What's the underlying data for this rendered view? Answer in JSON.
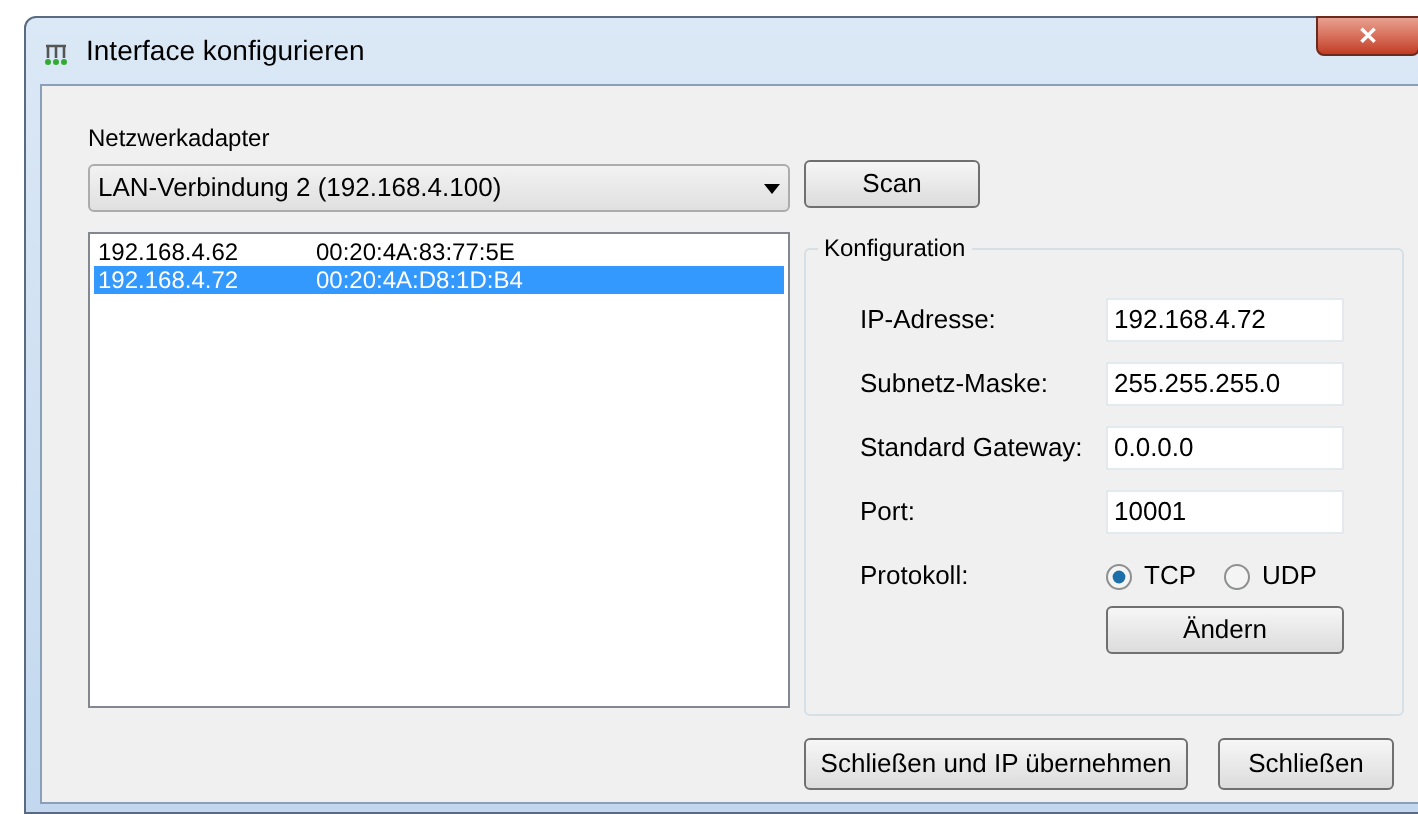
{
  "window": {
    "title": "Interface konfigurieren",
    "close": "✕"
  },
  "adapter": {
    "label": "Netzwerkadapter",
    "value": "LAN-Verbindung 2 (192.168.4.100)",
    "scan": "Scan"
  },
  "devices": [
    {
      "ip": "192.168.4.62",
      "mac": "00:20:4A:83:77:5E",
      "selected": false
    },
    {
      "ip": "192.168.4.72",
      "mac": "00:20:4A:D8:1D:B4",
      "selected": true
    }
  ],
  "config": {
    "title": "Konfiguration",
    "fields": [
      {
        "label": "IP-Adresse:",
        "value": "192.168.4.72"
      },
      {
        "label": "Subnetz-Maske:",
        "value": "255.255.255.0"
      },
      {
        "label": "Standard Gateway:",
        "value": "0.0.0.0"
      },
      {
        "label": "Port:",
        "value": "10001"
      }
    ],
    "protocol": {
      "label": "Protokoll:",
      "options": [
        {
          "label": "TCP",
          "selected": true
        },
        {
          "label": "UDP",
          "selected": false
        }
      ]
    },
    "apply": "Ändern"
  },
  "buttons": [
    "Schließen und IP übernehmen",
    "Schließen"
  ]
}
